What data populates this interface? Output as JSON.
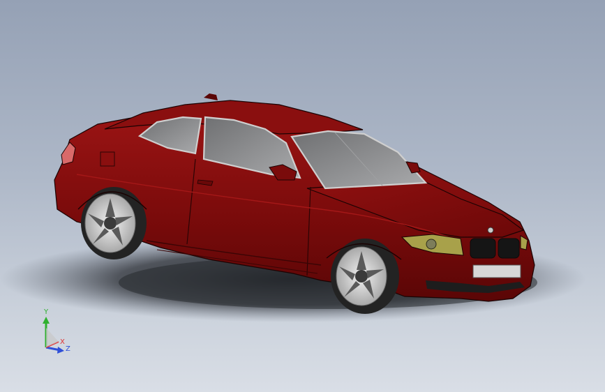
{
  "viewport": {
    "background_top": "#95a1b5",
    "background_bottom": "#d9dee6"
  },
  "model": {
    "body_color": "#7d0a0a",
    "glass_color": "#8f9092",
    "rim_color": "#c9c9c9",
    "tire_color": "#2a2a2a"
  },
  "triad": {
    "x_label": "X",
    "y_label": "Y",
    "z_label": "Z",
    "x_color": "#e03030",
    "y_color": "#2fb02f",
    "z_color": "#2f4fd8"
  }
}
